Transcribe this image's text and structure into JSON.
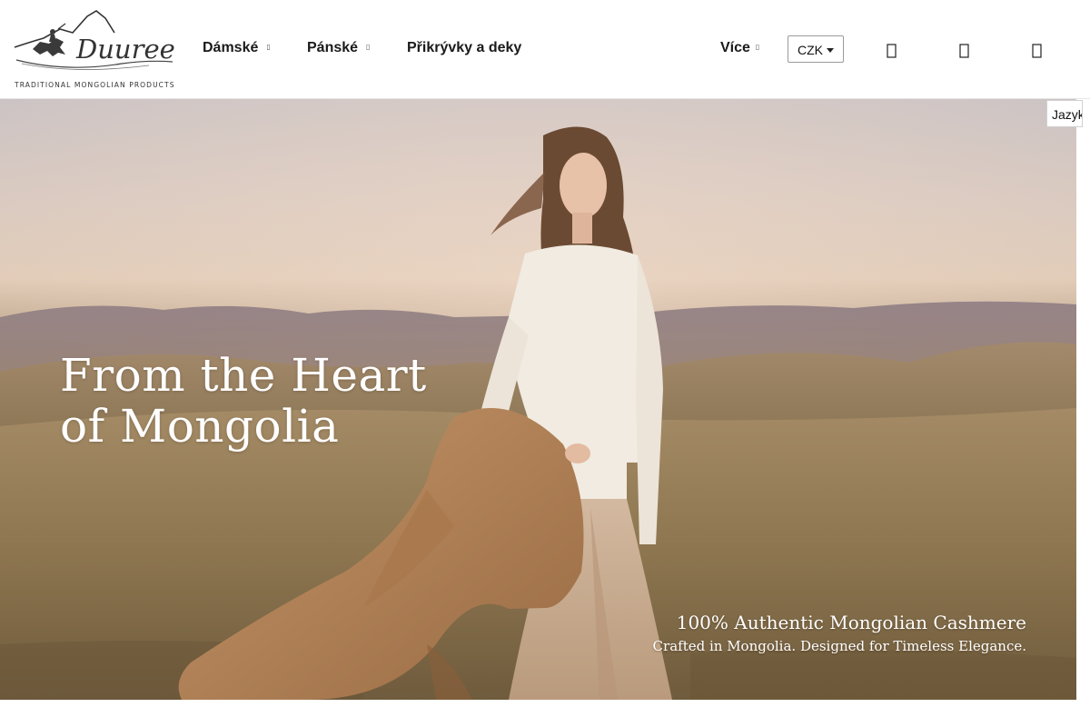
{
  "header": {
    "logo": {
      "wordmark": "Duuree.cz",
      "tagline": "TRADITIONAL MONGOLIAN PRODUCTS"
    },
    "nav": [
      {
        "label": "Dámské",
        "has_submenu": true
      },
      {
        "label": "Pánské",
        "has_submenu": true
      },
      {
        "label": "Přikrývky a deky",
        "has_submenu": false
      }
    ],
    "more": {
      "label": "Více",
      "has_submenu": true
    },
    "currency": {
      "selected": "CZK"
    },
    "icons": [
      "search-icon",
      "user-icon",
      "cart-icon"
    ]
  },
  "language": {
    "label": "Jazyk"
  },
  "hero": {
    "title_line1": "From the Heart",
    "title_line2": "of Mongolia",
    "subtitle_line1": "100% Authentic Mongolian Cashmere",
    "subtitle_line2": "Crafted in Mongolia. Designed for Timeless Elegance."
  },
  "colors": {
    "text": "#1a1a1a",
    "hero_text": "#ffffff",
    "coat": "#b98757",
    "sweater": "#f1ebe1"
  }
}
